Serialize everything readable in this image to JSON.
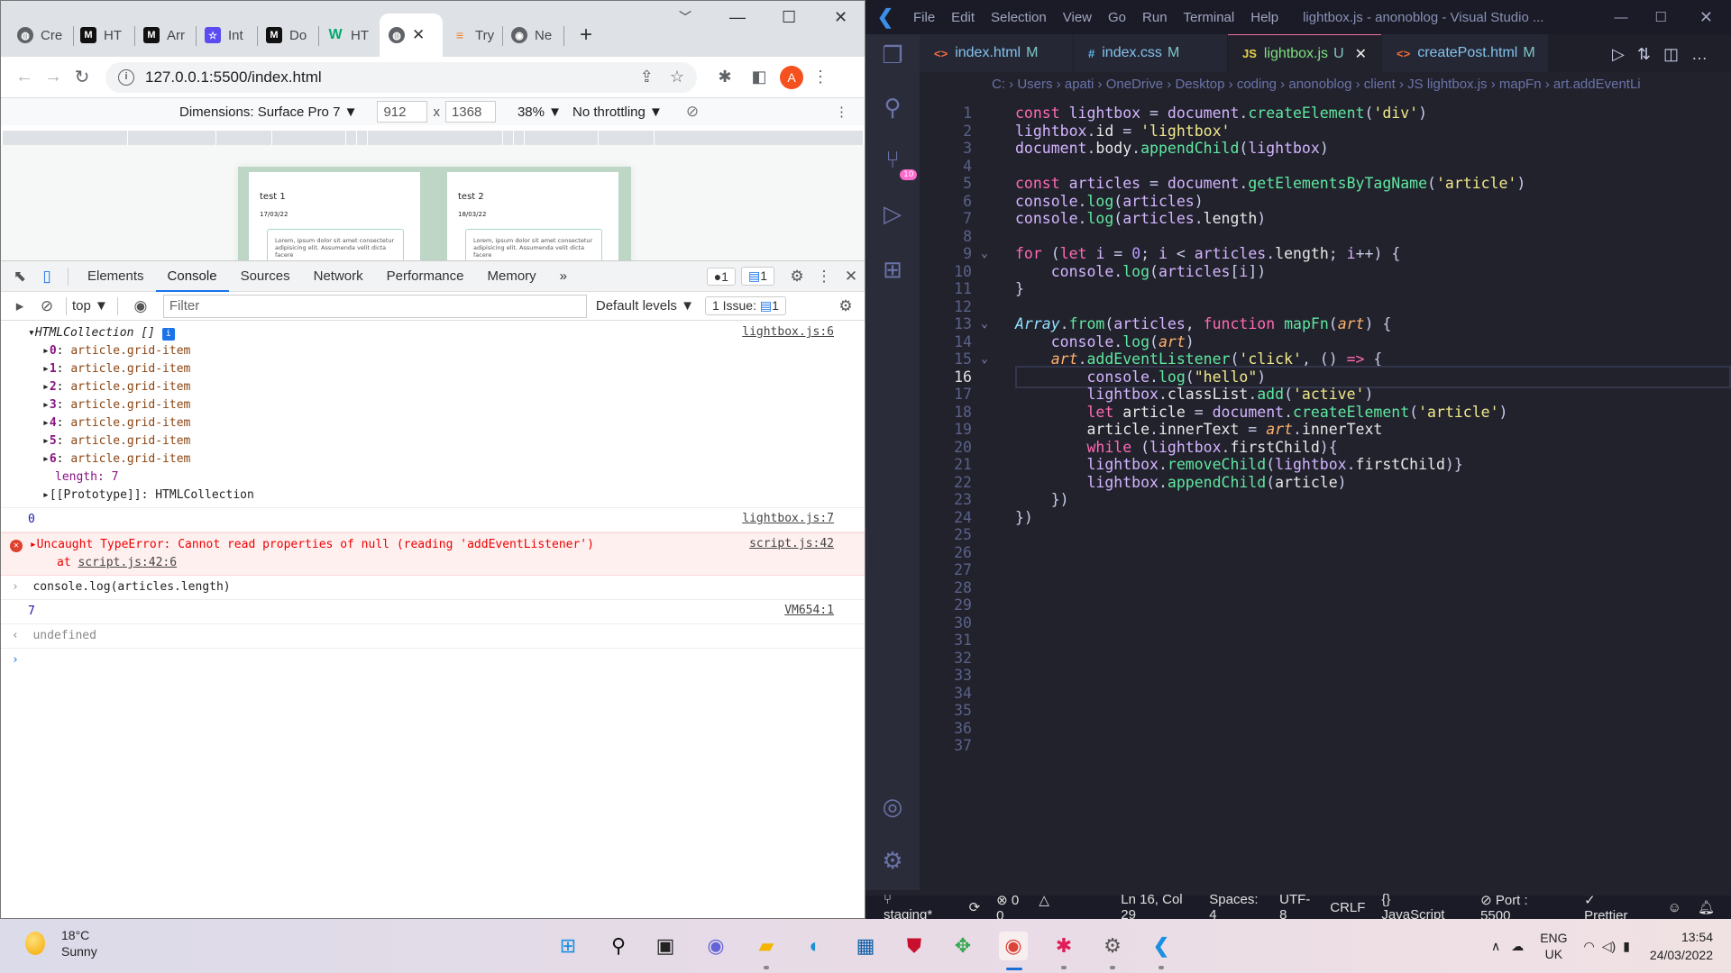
{
  "chrome": {
    "tabs": [
      {
        "label": "Cre",
        "icon": "globe-icon"
      },
      {
        "label": "HT",
        "icon": "mdn-icon"
      },
      {
        "label": "Arr",
        "icon": "mdn-icon"
      },
      {
        "label": "Int",
        "icon": "star-icon"
      },
      {
        "label": "Do",
        "icon": "mdn-icon"
      },
      {
        "label": "HT",
        "icon": "w3schools-icon"
      },
      {
        "label": "",
        "icon": "globe-icon",
        "active": true
      },
      {
        "label": "Try",
        "icon": "stackoverflow-icon"
      },
      {
        "label": "Ne",
        "icon": "chrome-icon"
      }
    ],
    "new_tab": "+",
    "url": "127.0.0.1:5500/index.html",
    "avatar_letter": "A",
    "device_toolbar": {
      "dimensions": "Dimensions: Surface Pro 7 ▼",
      "width": "912",
      "times": "x",
      "height": "1368",
      "zoom": "38% ▼",
      "throttling": "No throttling ▼"
    },
    "page_cards": [
      {
        "title": "test 1",
        "date": "17/03/22",
        "body": "Lorem, ipsum dolor sit amet consectetur adipisicing elit. Assumenda velit dicta facere"
      },
      {
        "title": "test 2",
        "date": "18/03/22",
        "body": "Lorem, ipsum dolor sit amet consectetur adipisicing elit. Assumenda velit dicta facere"
      }
    ]
  },
  "devtools": {
    "tabs": [
      "Elements",
      "Console",
      "Sources",
      "Network",
      "Performance",
      "Memory"
    ],
    "active_tab": "Console",
    "more": "»",
    "errors_count": "1",
    "messages_count": "1",
    "context": "top ▼",
    "filter_placeholder": "Filter",
    "levels": "Default levels ▼",
    "issues": "1 Issue:",
    "issues_count": "1",
    "console": {
      "collection_header": "HTMLCollection []",
      "collection_src": "lightbox.js:6",
      "items": [
        {
          "idx": "0",
          "val": "article.grid-item"
        },
        {
          "idx": "1",
          "val": "article.grid-item"
        },
        {
          "idx": "2",
          "val": "article.grid-item"
        },
        {
          "idx": "3",
          "val": "article.grid-item"
        },
        {
          "idx": "4",
          "val": "article.grid-item"
        },
        {
          "idx": "5",
          "val": "article.grid-item"
        },
        {
          "idx": "6",
          "val": "article.grid-item"
        }
      ],
      "length_label": "length: 7",
      "prototype": "[[Prototype]]: HTMLCollection",
      "zero_value": "0",
      "zero_src": "lightbox.js:7",
      "error_text": "Uncaught TypeError: Cannot read properties of null (reading 'addEventListener')",
      "error_at": "at",
      "error_link": "script.js:42:6",
      "error_src": "script.js:42",
      "input_cmd": "console.log(articles.length)",
      "output_value": "7",
      "output_src": "VM654:1",
      "return_value": "undefined"
    }
  },
  "vscode": {
    "menu": [
      "File",
      "Edit",
      "Selection",
      "View",
      "Go",
      "Run",
      "Terminal",
      "Help"
    ],
    "title": "lightbox.js - anonoblog - Visual Studio ...",
    "source_control_badge": "10",
    "tabs": [
      {
        "icon": "<>",
        "name": "index.html",
        "status": "M",
        "icon_color": "#f26b3a"
      },
      {
        "icon": "#",
        "name": "index.css",
        "status": "M",
        "icon_color": "#5fb0e8"
      },
      {
        "icon": "JS",
        "name": "lightbox.js",
        "status": "U",
        "icon_color": "#e6d44c",
        "active": true
      },
      {
        "icon": "<>",
        "name": "createPost.html",
        "status": "M",
        "icon_color": "#f26b3a"
      }
    ],
    "breadcrumbs": [
      "C:",
      "Users",
      "apati",
      "OneDrive",
      "Desktop",
      "coding",
      "anonoblog",
      "client",
      "JS lightbox.js",
      "mapFn",
      "art.addEventLi"
    ],
    "current_line": 16,
    "code_lines": [
      "const lightbox = document.createElement('div')",
      "lightbox.id = 'lightbox'",
      "document.body.appendChild(lightbox)",
      "",
      "const articles = document.getElementsByTagName('article')",
      "console.log(articles)",
      "console.log(articles.length)",
      "",
      "for (let i = 0; i < articles.length; i++) {",
      "    console.log(articles[i])",
      "}",
      "",
      "Array.from(articles, function mapFn(art) {",
      "    console.log(art)",
      "    art.addEventListener('click', () => {",
      "        console.log(\"hello\")",
      "        lightbox.classList.add('active')",
      "        let article = document.createElement('article')",
      "        article.innerText = art.innerText",
      "        while (lightbox.firstChild){",
      "        lightbox.removeChild(lightbox.firstChild)}",
      "        lightbox.appendChild(article)",
      "    })",
      "})",
      "",
      "",
      "",
      "",
      "",
      "",
      "",
      "",
      "",
      "",
      "",
      "",
      ""
    ],
    "status": {
      "branch": "staging*",
      "errors": "0",
      "warnings": "0",
      "position": "Ln 16, Col 29",
      "spaces": "Spaces: 4",
      "encoding": "UTF-8",
      "eol": "CRLF",
      "language": "JavaScript",
      "port": "Port : 5500",
      "prettier": "Prettier"
    }
  },
  "taskbar": {
    "temperature": "18°C",
    "condition": "Sunny",
    "lang_top": "ENG",
    "lang_bottom": "UK",
    "time": "13:54",
    "date": "24/03/2022"
  }
}
